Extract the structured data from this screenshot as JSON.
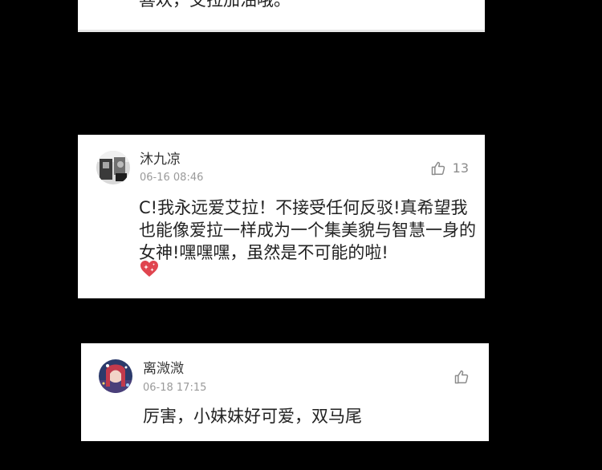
{
  "comments": [
    {
      "id": "c0",
      "text": "喜欢，艾拉加油哦。"
    },
    {
      "id": "c1",
      "username": "沐九凉",
      "timestamp": "06-16 08:46",
      "like_count": "13",
      "text": "C!我永远爱艾拉！不接受任何反驳!真希望我也能像爱拉一样成为一个集美貌与智慧一身的女神!嘿嘿嘿，虽然是不可能的啦!",
      "emoji": "sparkle-heart"
    },
    {
      "id": "c2",
      "username": "离溦溦",
      "timestamp": "06-18 17:15",
      "like_count": "",
      "text": "厉害，小妹妹好可爱，双马尾"
    }
  ],
  "icons": {
    "like": "thumbs-up-icon",
    "heart": "sparkle-heart-icon"
  },
  "colors": {
    "background": "#000000",
    "card": "#ffffff",
    "heart": "#e0454f",
    "meta_text": "#9a9a9a"
  }
}
